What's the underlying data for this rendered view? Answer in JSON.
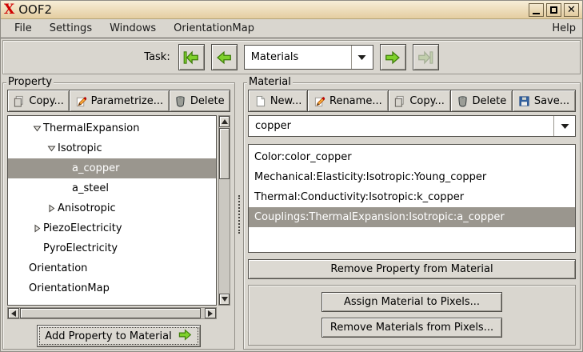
{
  "colors": {
    "titlebar_bg": "#ecd9ae",
    "accent_green": "#73d216",
    "selection_bg": "#9a968e",
    "panel_bg": "#d9d6cf",
    "list_bg": "#ffffff"
  },
  "window": {
    "title": "OOF2"
  },
  "menubar": {
    "items": [
      "File",
      "Settings",
      "Windows",
      "OrientationMap"
    ],
    "help": "Help"
  },
  "taskbar": {
    "label": "Task:",
    "selected_task": "Materials",
    "nav_buttons": [
      {
        "name": "task-first-button",
        "icon": "arrow-first-icon",
        "disabled": false
      },
      {
        "name": "task-back-button",
        "icon": "arrow-back-icon",
        "disabled": false
      },
      {
        "name": "task-next-button",
        "icon": "arrow-next-icon",
        "disabled": false
      },
      {
        "name": "task-last-button",
        "icon": "arrow-last-icon",
        "disabled": true
      }
    ]
  },
  "property_panel": {
    "title": "Property",
    "toolbar": [
      {
        "label": "Copy...",
        "icon": "copy-icon",
        "name": "property-copy-button"
      },
      {
        "label": "Parametrize...",
        "icon": "pencil-icon",
        "name": "property-parametrize-button"
      },
      {
        "label": "Delete",
        "icon": "trash-icon",
        "name": "property-delete-button"
      }
    ],
    "tree": [
      {
        "label": "ThermalExpansion",
        "depth": 1,
        "expander": "open",
        "selected": false
      },
      {
        "label": "Isotropic",
        "depth": 2,
        "expander": "open",
        "selected": false
      },
      {
        "label": "a_copper",
        "depth": 3,
        "expander": "none",
        "selected": true
      },
      {
        "label": "a_steel",
        "depth": 3,
        "expander": "none",
        "selected": false
      },
      {
        "label": "Anisotropic",
        "depth": 2,
        "expander": "closed",
        "selected": false
      },
      {
        "label": "PiezoElectricity",
        "depth": 1,
        "expander": "closed",
        "selected": false
      },
      {
        "label": "PyroElectricity",
        "depth": 1,
        "expander": "none",
        "selected": false
      },
      {
        "label": "Orientation",
        "depth": 0,
        "expander": "none",
        "selected": false
      },
      {
        "label": "OrientationMap",
        "depth": 0,
        "expander": "none",
        "selected": false
      }
    ],
    "add_button": "Add Property to Material"
  },
  "material_panel": {
    "title": "Material",
    "toolbar": [
      {
        "label": "New...",
        "icon": "new-icon",
        "name": "material-new-button"
      },
      {
        "label": "Rename...",
        "icon": "pencil-icon",
        "name": "material-rename-button"
      },
      {
        "label": "Copy...",
        "icon": "copy-icon",
        "name": "material-copy-button"
      },
      {
        "label": "Delete",
        "icon": "trash-icon",
        "name": "material-delete-button"
      },
      {
        "label": "Save...",
        "icon": "save-icon",
        "name": "material-save-button"
      }
    ],
    "selected_material": "copper",
    "properties": [
      {
        "label": "Color:color_copper",
        "selected": false
      },
      {
        "label": "Mechanical:Elasticity:Isotropic:Young_copper",
        "selected": false
      },
      {
        "label": "Thermal:Conductivity:Isotropic:k_copper",
        "selected": false
      },
      {
        "label": "Couplings:ThermalExpansion:Isotropic:a_copper",
        "selected": true
      }
    ],
    "remove_button": "Remove Property from Material",
    "pixel_buttons": [
      {
        "label": "Assign Material to Pixels...",
        "name": "assign-material-button"
      },
      {
        "label": "Remove Materials from Pixels...",
        "name": "remove-materials-button"
      }
    ]
  }
}
